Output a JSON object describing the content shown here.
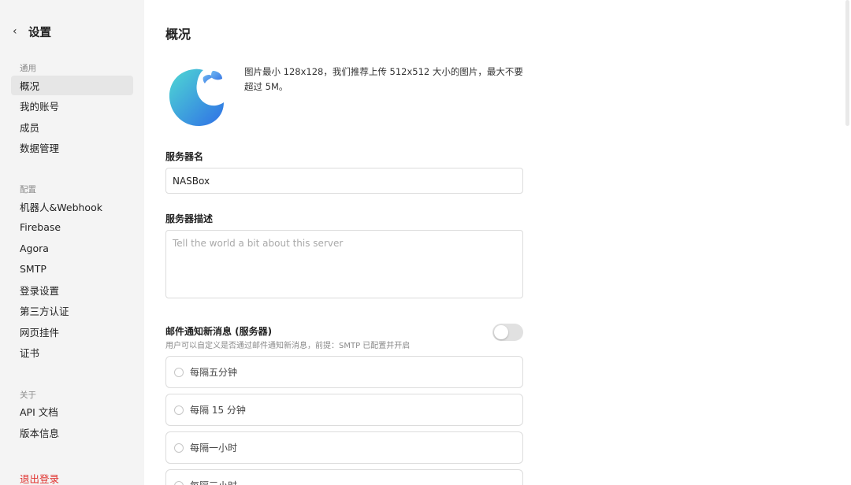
{
  "sidebar": {
    "back_title": "设置",
    "sections": [
      {
        "label": "通用",
        "items": [
          {
            "label": "概况",
            "active": true
          },
          {
            "label": "我的账号"
          },
          {
            "label": "成员"
          },
          {
            "label": "数据管理"
          }
        ]
      },
      {
        "label": "配置",
        "items": [
          {
            "label": "机器人&Webhook"
          },
          {
            "label": "Firebase"
          },
          {
            "label": "Agora"
          },
          {
            "label": "SMTP"
          },
          {
            "label": "登录设置"
          },
          {
            "label": "第三方认证"
          },
          {
            "label": "网页挂件"
          },
          {
            "label": "证书"
          }
        ]
      },
      {
        "label": "关于",
        "items": [
          {
            "label": "API 文档"
          },
          {
            "label": "版本信息"
          }
        ]
      }
    ],
    "logout_label": "退出登录"
  },
  "main": {
    "title": "概况",
    "avatar_hint": "图片最小 128x128，我们推荐上传 512x512 大小的图片，最大不要超过 5M。",
    "server_name": {
      "label": "服务器名",
      "value": "NASBox"
    },
    "server_desc": {
      "label": "服务器描述",
      "placeholder": "Tell the world a bit about this server",
      "value": ""
    },
    "email_notify": {
      "title": "邮件通知新消息 (服务器)",
      "description": "用户可以自定义是否通过邮件通知新消息，前提：SMTP 已配置并开启",
      "enabled": false,
      "options": [
        {
          "label": "每隔五分钟"
        },
        {
          "label": "每隔 15 分钟"
        },
        {
          "label": "每隔一小时"
        },
        {
          "label": "每隔三小时"
        }
      ]
    }
  },
  "colors": {
    "sidebar_bg": "#f4f4f4",
    "active_item_bg": "#e6e6e6",
    "danger": "#e0312d",
    "avatar_gradient_start": "#4fd8d3",
    "avatar_gradient_end": "#2f6fe6"
  }
}
